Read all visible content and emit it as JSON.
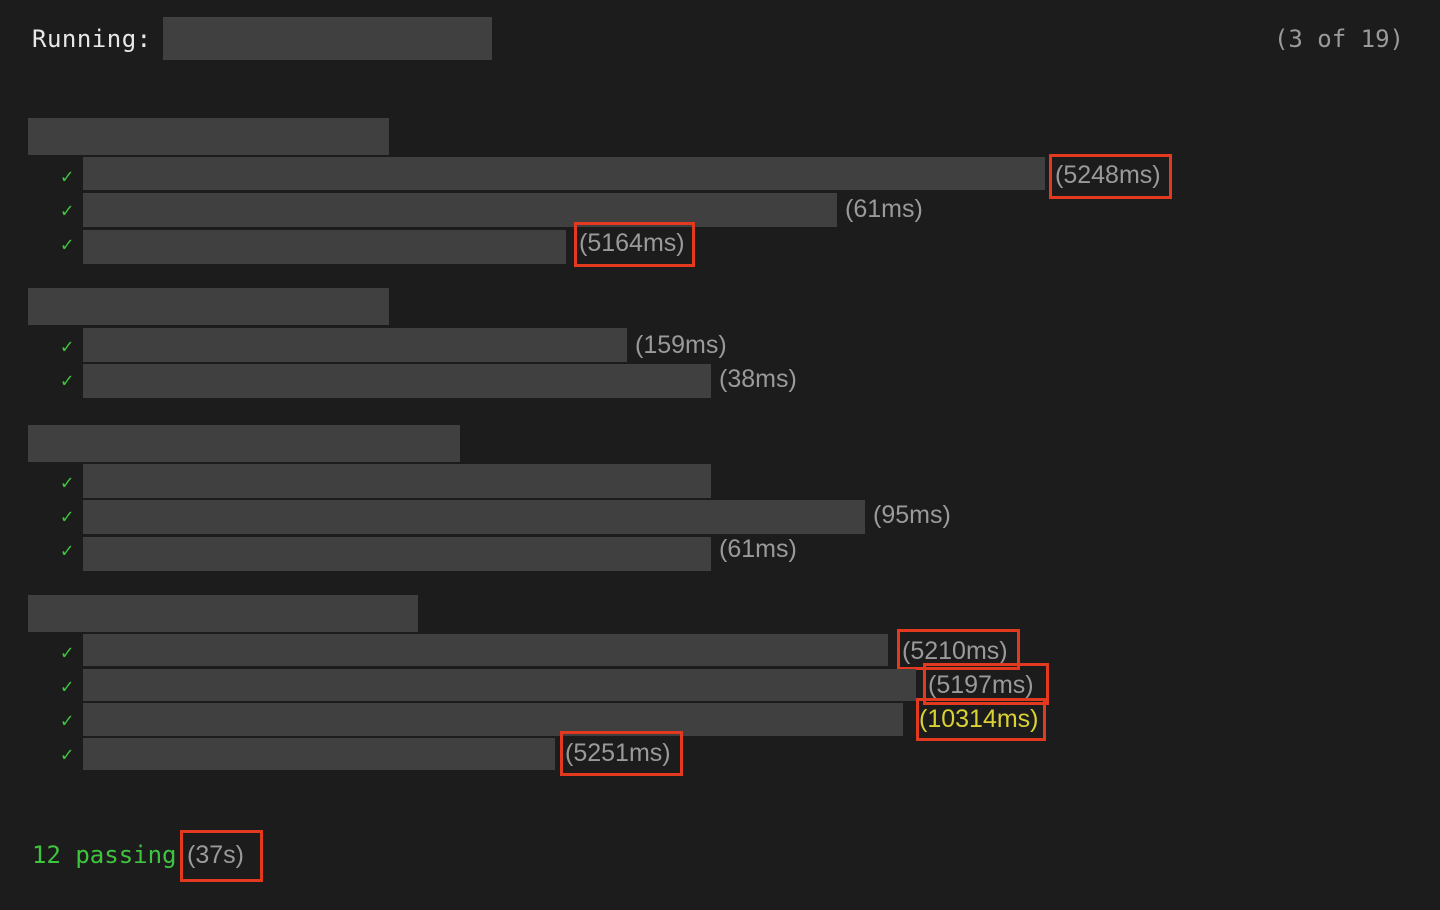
{
  "header": {
    "running_label": "Running:",
    "counter": "(3 of 19)"
  },
  "suites": [
    {
      "tests": [
        {
          "status": "pass",
          "check": "✓",
          "duration": "(5248ms)",
          "highlighted": true
        },
        {
          "status": "pass",
          "check": "✓",
          "duration": "(61ms)",
          "highlighted": false
        },
        {
          "status": "pass",
          "check": "✓",
          "duration": "(5164ms)",
          "highlighted": true
        }
      ]
    },
    {
      "tests": [
        {
          "status": "pass",
          "check": "✓",
          "duration": "(159ms)",
          "highlighted": false
        },
        {
          "status": "pass",
          "check": "✓",
          "duration": "(38ms)",
          "highlighted": false
        }
      ]
    },
    {
      "tests": [
        {
          "status": "pass",
          "check": "✓",
          "duration": "",
          "highlighted": false
        },
        {
          "status": "pass",
          "check": "✓",
          "duration": "(95ms)",
          "highlighted": false
        },
        {
          "status": "pass",
          "check": "✓",
          "duration": "(61ms)",
          "highlighted": false
        }
      ]
    },
    {
      "tests": [
        {
          "status": "pass",
          "check": "✓",
          "duration": "(5210ms)",
          "highlighted": true
        },
        {
          "status": "pass",
          "check": "✓",
          "duration": "(5197ms)",
          "highlighted": true
        },
        {
          "status": "pass",
          "check": "✓",
          "duration": "(10314ms)",
          "highlighted": true,
          "slow": true
        },
        {
          "status": "pass",
          "check": "✓",
          "duration": "(5251ms)",
          "highlighted": true
        }
      ]
    }
  ],
  "summary": {
    "passing": "12 passing",
    "duration": "(37s)",
    "duration_highlighted": true
  },
  "colors": {
    "background": "#1c1c1c",
    "pass": "#3fc43f",
    "duration": "#9a9a9a",
    "slow": "#d9d232",
    "highlight_box": "#e3391f",
    "redaction": "#404040"
  }
}
